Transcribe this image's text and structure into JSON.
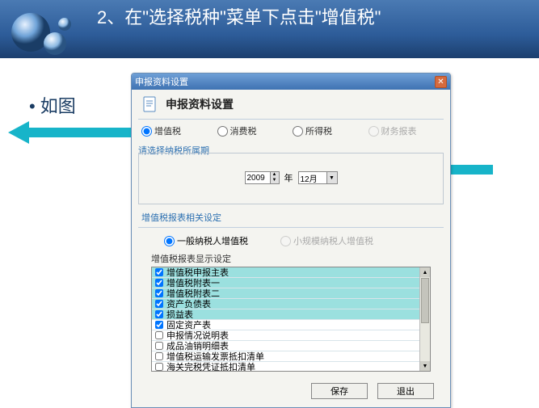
{
  "banner": {
    "title": "2、在\"选择税种\"菜单下点击\"增值税\""
  },
  "aside": {
    "label": "如图"
  },
  "window": {
    "title": "申报资料设置",
    "header": "申报资料设置",
    "taxTypes": {
      "opt1": "增值税",
      "opt2": "消费税",
      "opt3": "所得税",
      "opt4": "财务报表"
    },
    "periodSection": "请选择纳税所属期",
    "year": "2009",
    "yearSuffix": "年",
    "month": "12月",
    "vatSection": "增值税报表相关设定",
    "taxpayerType": {
      "normal": "一般纳税人增值税",
      "small": "小规模纳税人增值税"
    },
    "listLabel": "增值税报表显示设定",
    "listItems": [
      {
        "label": "增值税申报主表",
        "checked": true,
        "sel": true
      },
      {
        "label": "增值税附表一",
        "checked": true,
        "sel": true
      },
      {
        "label": "增值税附表二",
        "checked": true,
        "sel": true
      },
      {
        "label": "资产负债表",
        "checked": true,
        "sel": true
      },
      {
        "label": "损益表",
        "checked": true,
        "sel": true
      },
      {
        "label": "固定资产表",
        "checked": true,
        "sel": false
      },
      {
        "label": "申报情况说明表",
        "checked": false,
        "sel": false
      },
      {
        "label": "成品油销明细表",
        "checked": false,
        "sel": false
      },
      {
        "label": "增值税运输发票抵扣清单",
        "checked": false,
        "sel": false
      },
      {
        "label": "海关完税凭证抵扣清单",
        "checked": false,
        "sel": false
      }
    ],
    "buttons": {
      "save": "保存",
      "exit": "退出"
    }
  }
}
